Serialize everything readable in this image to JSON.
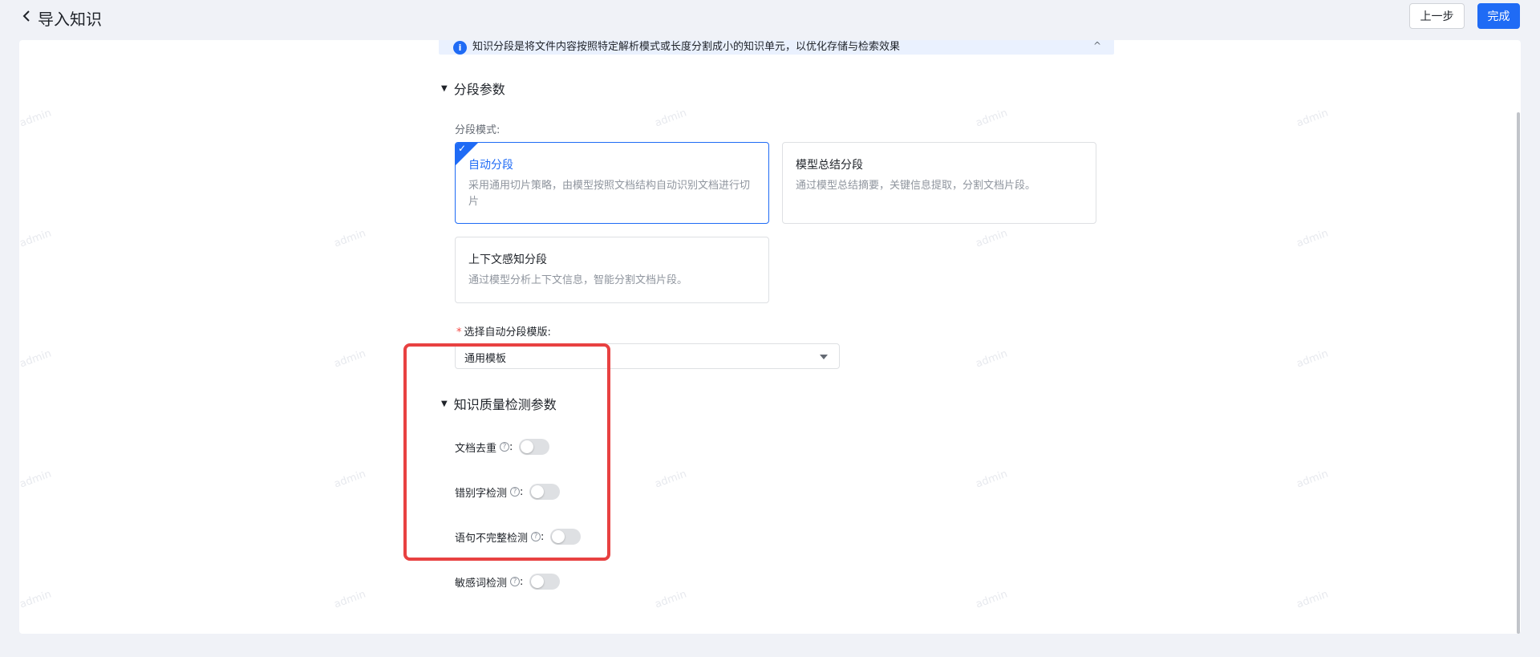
{
  "header": {
    "title": "导入知识",
    "prev_label": "上一步",
    "done_label": "完成"
  },
  "banner": {
    "text": "知识分段是将文件内容按照特定解析模式或长度分割成小的知识单元，以优化存储与检索效果",
    "collapse": "^"
  },
  "segment": {
    "section_title": "分段参数",
    "mode_label": "分段模式:",
    "modes": [
      {
        "title": "自动分段",
        "desc": "采用通用切片策略，由模型按照文档结构自动识别文档进行切片",
        "selected": true
      },
      {
        "title": "模型总结分段",
        "desc": "通过模型总结摘要，关键信息提取，分割文档片段。",
        "selected": false
      },
      {
        "title": "上下文感知分段",
        "desc": "通过模型分析上下文信息，智能分割文档片段。",
        "selected": false
      }
    ],
    "template_label": "选择自动分段模版:",
    "template_required": "*",
    "template_value": "通用模板"
  },
  "quality": {
    "section_title": "知识质量检测参数",
    "items": [
      {
        "label": "文档去重",
        "enabled": false
      },
      {
        "label": "错别字检测",
        "enabled": false
      },
      {
        "label": "语句不完整检测",
        "enabled": false
      },
      {
        "label": "敏感词检测",
        "enabled": false
      }
    ],
    "help_glyph": "?",
    "colon": ":"
  },
  "watermark_text": "admin",
  "colors": {
    "accent": "#1f6bf5",
    "highlight": "#e84141"
  }
}
